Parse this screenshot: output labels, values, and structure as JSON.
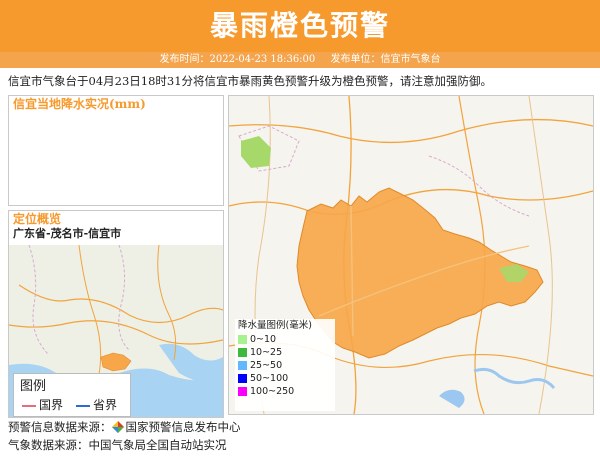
{
  "title": "暴雨橙色预警",
  "meta": {
    "publish_time_label": "发布时间：",
    "publish_time": "2022-04-23 18:36:00",
    "publisher_label": "发布单位：",
    "publisher": "信宜市气象台"
  },
  "notice": "信宜市气象台于04月23日18时31分将信宜市暴雨黄色预警升级为橙色预警，请注意加强防御。",
  "rain_panel": {
    "title": "信宜当地降水实况(mm)"
  },
  "location_panel": {
    "title": "定位概览",
    "region": "广东省-茂名市-信宜市",
    "legend": {
      "title": "图例",
      "items": [
        {
          "label": "国界",
          "color": "#e0707a"
        },
        {
          "label": "省界",
          "color": "#2a6bd8"
        }
      ]
    }
  },
  "main_map": {
    "legend_title": "降水量图例(毫米)",
    "legend_items": [
      {
        "label": "0~10",
        "color": "#a6f28f"
      },
      {
        "label": "10~25",
        "color": "#3dba3d"
      },
      {
        "label": "25~50",
        "color": "#61b8ff"
      },
      {
        "label": "50~100",
        "color": "#0000fe"
      },
      {
        "label": "100~250",
        "color": "#fa00fa"
      }
    ],
    "warning_fill": "#f7a64a"
  },
  "footer": {
    "warning_source_label": "预警信息数据来源：",
    "warning_source": "国家预警信息发布中心",
    "weather_source": "气象数据来源：中国气象局全国自动站实况"
  },
  "colors": {
    "accent": "#f79a2e"
  }
}
